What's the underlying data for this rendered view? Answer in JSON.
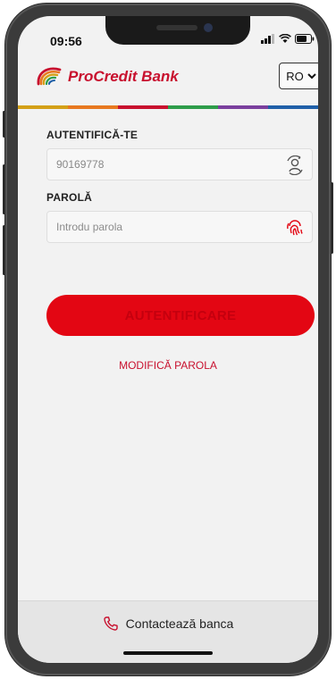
{
  "status_bar": {
    "time": "09:56"
  },
  "header": {
    "brand": "ProCredit Bank",
    "language": "RO",
    "stripe_colors": [
      "#d4a017",
      "#e8791f",
      "#c8102e",
      "#2e9d4a",
      "#7b3f9e",
      "#1f5fa8"
    ]
  },
  "login": {
    "username_label": "AUTENTIFICĂ-TE",
    "username_value": "90169778",
    "password_label": "PAROLĂ",
    "password_placeholder": "Introdu parola",
    "submit_label": "AUTENTIFICARE",
    "modify_password_label": "MODIFICĂ PAROLA"
  },
  "footer": {
    "contact_label": "Contactează banca"
  },
  "colors": {
    "accent": "#e30613",
    "brand_text": "#c8102e"
  }
}
